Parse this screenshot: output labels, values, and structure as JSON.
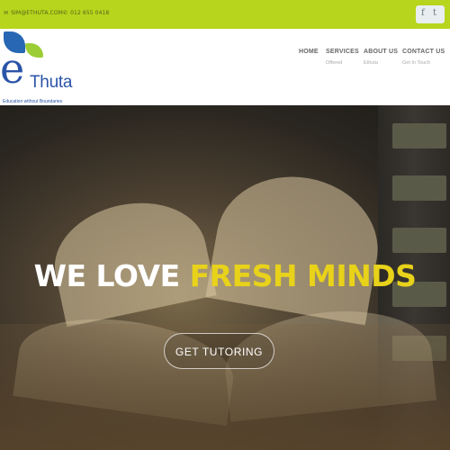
{
  "topbar": {
    "email": "SIM@ETHUTA.COM",
    "phone": "012 655 0418",
    "social": [
      "f",
      "t"
    ]
  },
  "logo": {
    "wordmark_e": "e",
    "wordmark_rest": "Thuta",
    "tagline": "Education without Boundaries"
  },
  "nav": [
    {
      "label": "HOME",
      "sub": ""
    },
    {
      "label": "SERVICES",
      "sub": "Offered"
    },
    {
      "label": "ABOUT US",
      "sub": "Ethuta"
    },
    {
      "label": "CONTACT US",
      "sub": "Get In Touch"
    }
  ],
  "hero": {
    "headline_plain": "WE LOVE",
    "headline_accent": "FRESH MINDS",
    "cta_label": "GET TUTORING"
  },
  "colors": {
    "topbar": "#b7d51c",
    "brand_blue": "#2a54a8",
    "brand_green": "#9ccd35",
    "accent_yellow": "#e8d21a"
  }
}
